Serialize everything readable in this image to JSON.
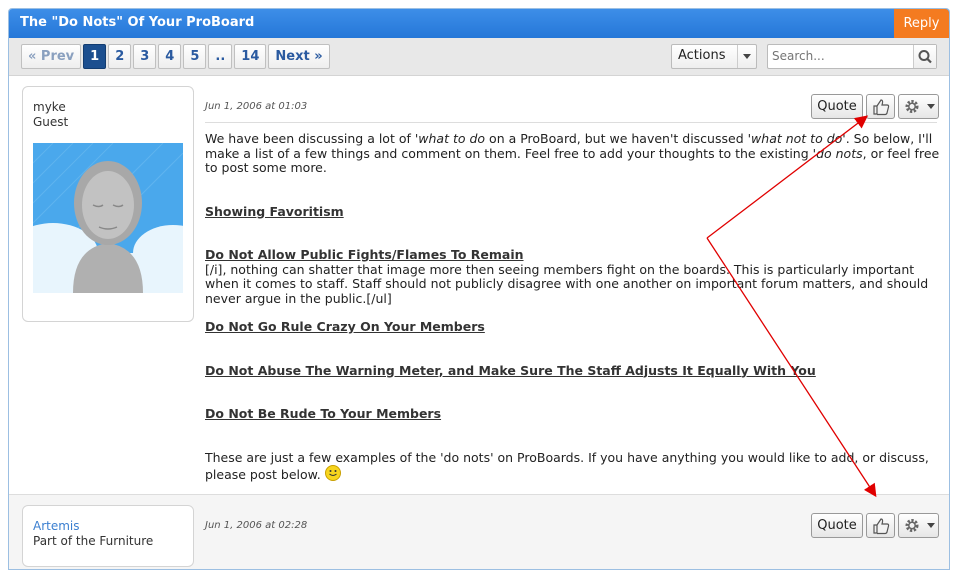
{
  "thread": {
    "title": "The \"Do Nots\" Of Your ProBoard",
    "reply_label": "Reply"
  },
  "pager": {
    "prev_label": "« Prev",
    "pages": [
      "1",
      "2",
      "3",
      "4",
      "5",
      "..",
      "14"
    ],
    "active_page": "1",
    "next_label": "Next »"
  },
  "actions": {
    "label": "Actions"
  },
  "search": {
    "placeholder": "Search..."
  },
  "posts": [
    {
      "username": "myke",
      "rank": "Guest",
      "date": "Jun 1, 2006 at 01:03",
      "quote_label": "Quote",
      "paragraphs": {
        "intro_1": "We have been discussing a lot of '",
        "intro_em1": "what to do",
        "intro_2": " on a ProBoard, but we haven't discussed '",
        "intro_em2": "what not to do",
        "intro_3": "'. So below, I'll make a list of a few things and comment on them. Feel free to add your thoughts to the existing '",
        "intro_em3": "do nots",
        "intro_4": ", or feel free to post some more.",
        "h1": "Showing Favoritism",
        "h2": "Do Not Allow Public Fights/Flames To Remain",
        "p2": "[/i], nothing can shatter that image more then seeing members fight on the boards. This is particularly important when it comes to staff. Staff should not publicly disagree with one another on important forum matters, and should never argue in the public.[/ul]",
        "h3": "Do Not Go Rule Crazy On Your Members",
        "h4": "Do Not Abuse The Warning Meter, and Make Sure The Staff Adjusts It Equally With You",
        "h5": "Do Not Be Rude To Your Members",
        "outro": "These are just a few examples of the 'do nots' on ProBoards. If you have anything you would like to add, or discuss, please post below. "
      }
    },
    {
      "username": "Artemis",
      "rank": "Part of the Furniture",
      "date": "Jun 1, 2006 at 02:28",
      "quote_label": "Quote"
    }
  ],
  "colors": {
    "header": "#2a7de0",
    "reply": "#f47b20",
    "annotation_arrow": "#e00000"
  }
}
